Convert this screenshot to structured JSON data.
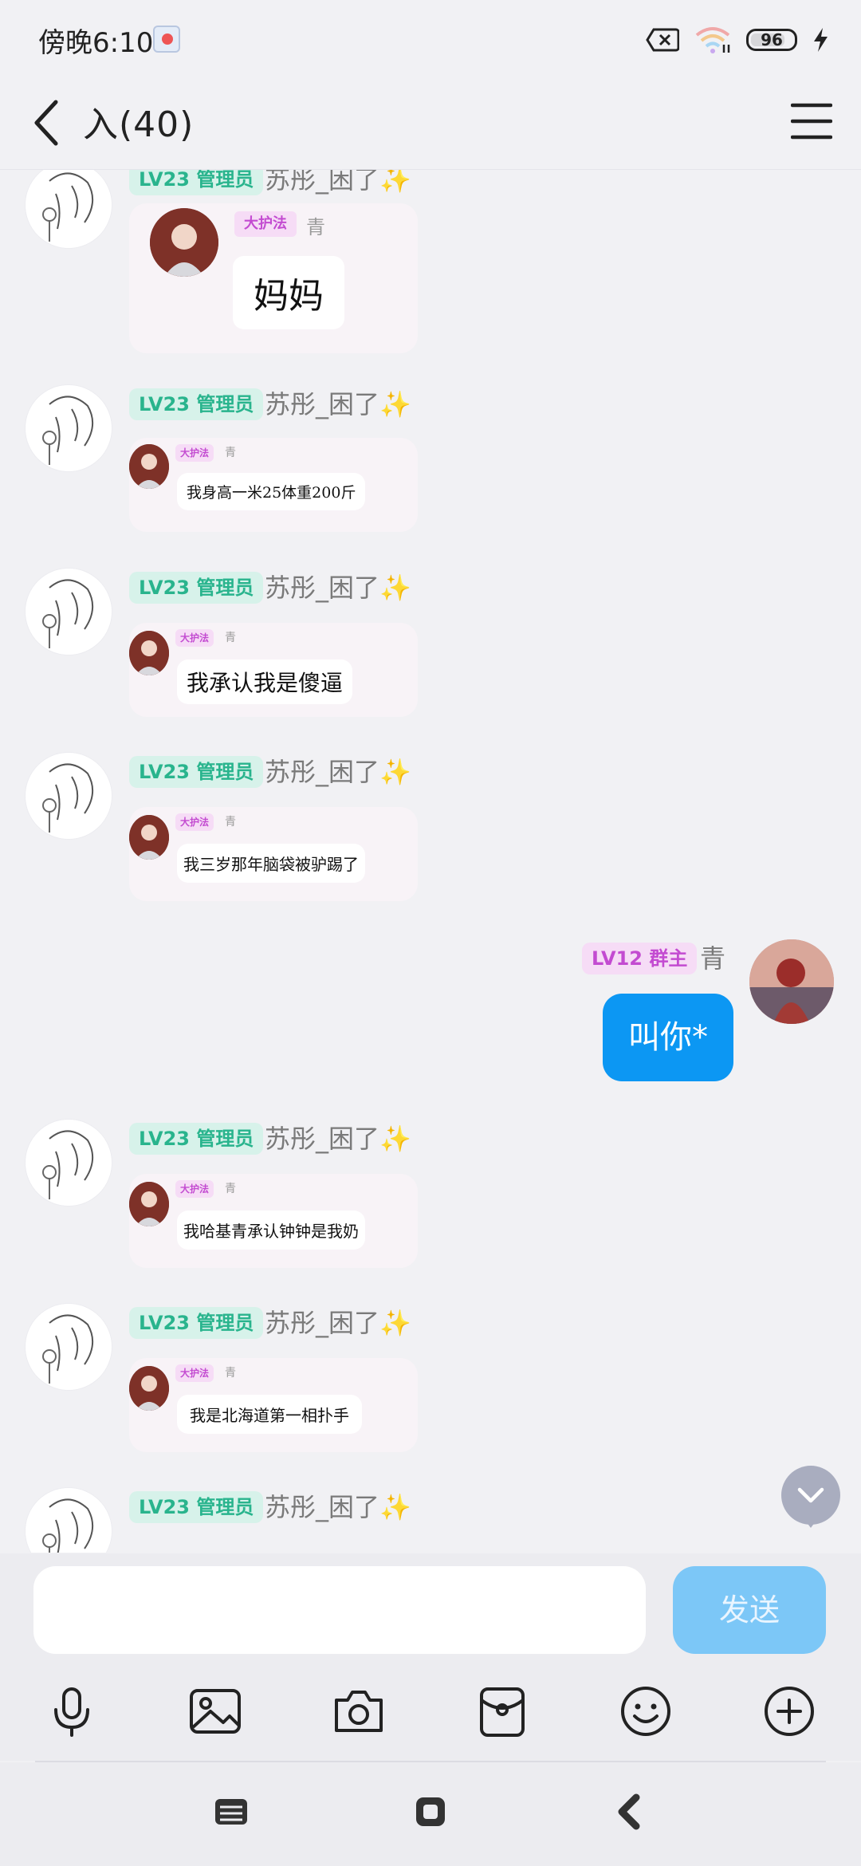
{
  "status_bar": {
    "time": "傍晚6:10",
    "battery": "96"
  },
  "header": {
    "title": "入(40)"
  },
  "messages": [
    {
      "badge": "LV23 管理员",
      "sender": "苏彤_困了",
      "spark": "✨",
      "card_tag": "大护法",
      "card_nick": "青",
      "card_text": "妈妈"
    },
    {
      "badge": "LV23 管理员",
      "sender": "苏彤_困了",
      "spark": "✨",
      "card_tag": "大护法",
      "card_nick": "青",
      "card_text": "我身高一米25体重200斤"
    },
    {
      "badge": "LV23 管理员",
      "sender": "苏彤_困了",
      "spark": "✨",
      "card_tag": "大护法",
      "card_nick": "青",
      "card_text": "我承认我是傻逼"
    },
    {
      "badge": "LV23 管理员",
      "sender": "苏彤_困了",
      "spark": "✨",
      "card_tag": "大护法",
      "card_nick": "青",
      "card_text": "我三岁那年脑袋被驴踢了"
    },
    {
      "badge": "LV23 管理员",
      "sender": "苏彤_困了",
      "spark": "✨",
      "card_tag": "大护法",
      "card_nick": "青",
      "card_text": "我哈基青承认钟钟是我奶"
    },
    {
      "badge": "LV23 管理员",
      "sender": "苏彤_困了",
      "spark": "✨",
      "card_tag": "大护法",
      "card_nick": "青",
      "card_text": "我是北海道第一相扑手"
    },
    {
      "badge": "LV23 管理员",
      "sender": "苏彤_困了",
      "spark": "✨"
    }
  ],
  "my_message": {
    "badge": "LV12 群主",
    "nick": "青",
    "text": "叫你*"
  },
  "input": {
    "placeholder": "",
    "value": "",
    "send_label": "发送"
  },
  "colors": {
    "accent": "#0c97f3",
    "admin_badge": "#29b48d",
    "owner_badge": "#c34bd1"
  },
  "toolbar_icons": [
    "microphone-icon",
    "image-icon",
    "camera-icon",
    "red-packet-icon",
    "emoji-icon",
    "plus-icon"
  ]
}
